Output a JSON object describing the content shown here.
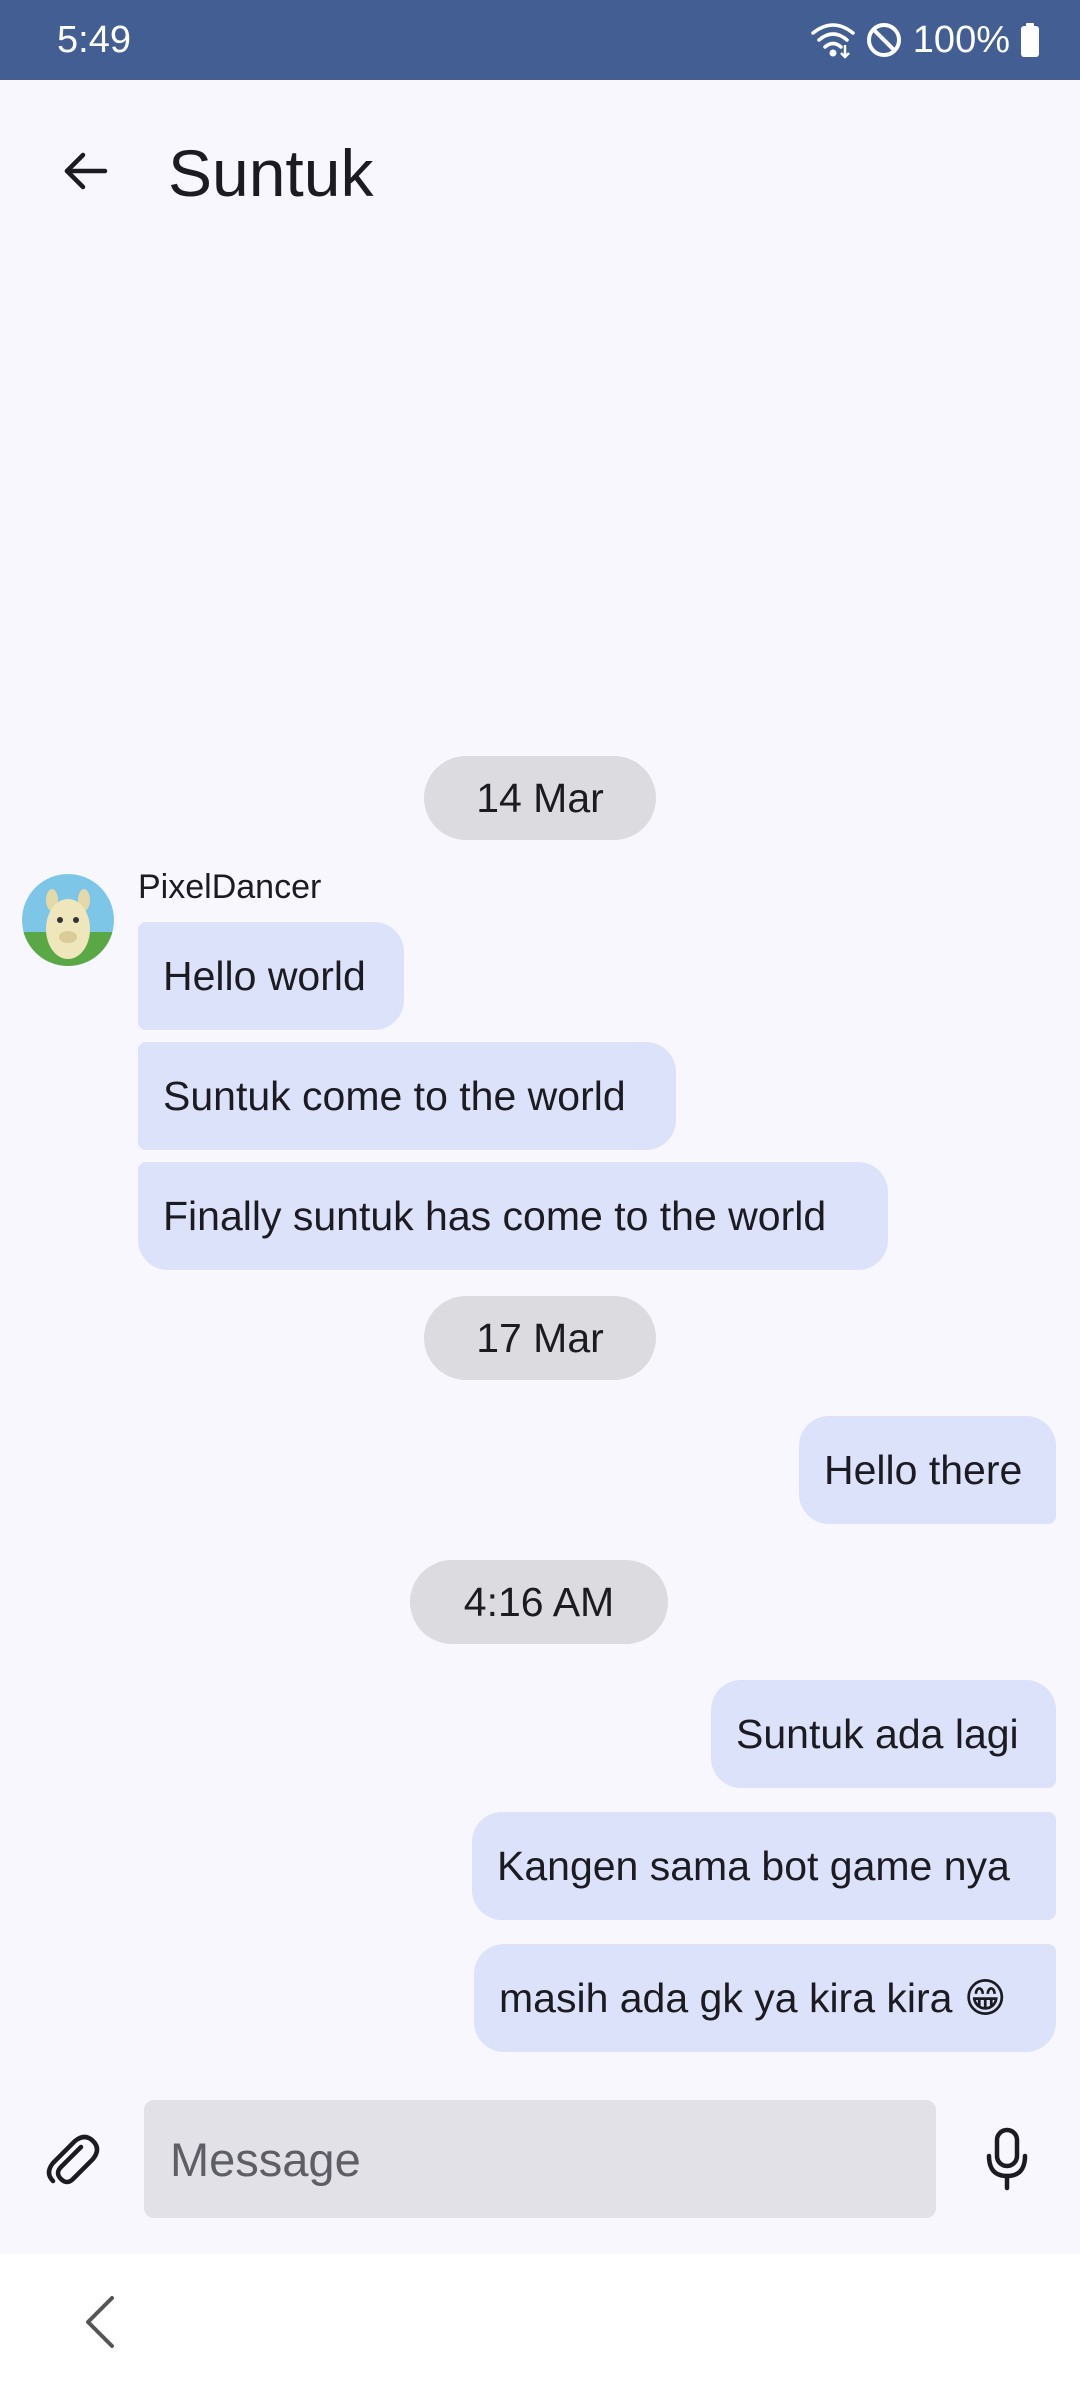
{
  "status_bar": {
    "time": "5:49",
    "battery": "100%",
    "icons": [
      "wifi-icon",
      "do-not-disturb-icon",
      "battery-icon"
    ]
  },
  "app_bar": {
    "title": "Suntuk",
    "back_icon": "back-arrow-icon"
  },
  "conversation": {
    "date_chips": [
      "14 Mar",
      "17 Mar",
      "4:16 AM"
    ],
    "sender": {
      "name": "PixelDancer",
      "avatar_icon": "llama-avatar"
    },
    "incoming": [
      "Hello world",
      "Suntuk come to the world",
      "Finally suntuk has come to the world"
    ],
    "outgoing": [
      "Hello there",
      "Suntuk ada lagi",
      "Kangen sama bot game nya",
      "masih ada gk ya kira kira 😁"
    ]
  },
  "composer": {
    "placeholder": "Message",
    "attach_icon": "paperclip-icon",
    "mic_icon": "microphone-icon"
  },
  "nav_bar": {
    "back_icon": "nav-back-icon"
  },
  "colors": {
    "status_bar": "#435e92",
    "background": "#f8f7fd",
    "bubble": "#dce2f9",
    "chip": "#dcdbe0",
    "input": "#e2e1e8"
  }
}
